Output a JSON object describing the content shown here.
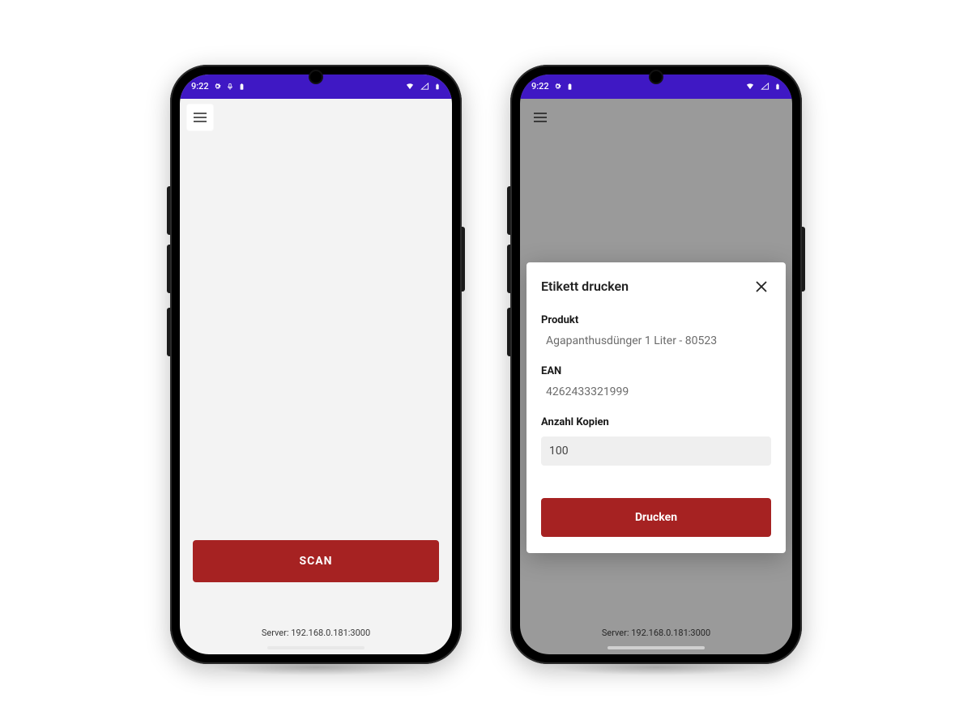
{
  "status": {
    "time": "9:22",
    "icons_left": [
      "gear-icon",
      "mic-icon",
      "battery-saver-icon"
    ],
    "icons_right": [
      "wifi-icon",
      "signal-icon",
      "battery-icon"
    ]
  },
  "status_right_only": {
    "time": "9:22",
    "icons_left": [
      "gear-icon",
      "battery-saver-icon"
    ],
    "icons_right": [
      "wifi-icon",
      "signal-icon",
      "battery-icon"
    ]
  },
  "screen1": {
    "scan_label": "SCAN",
    "server_line": "Server: 192.168.0.181:3000"
  },
  "screen2": {
    "server_line": "Server: 192.168.0.181:3000",
    "dialog": {
      "title": "Etikett drucken",
      "product_label": "Produkt",
      "product_value": "Agapanthusdünger 1 Liter - 80523",
      "ean_label": "EAN",
      "ean_value": "4262433321999",
      "copies_label": "Anzahl Kopien",
      "copies_value": "100",
      "print_label": "Drucken"
    }
  }
}
